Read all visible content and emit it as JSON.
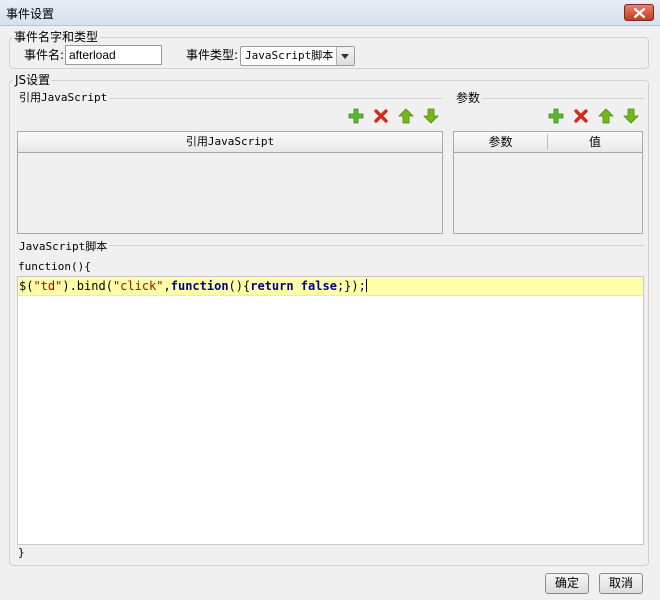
{
  "window": {
    "title": "事件设置"
  },
  "event_group": {
    "legend": "事件名字和类型",
    "name_label": "事件名:",
    "name_value": "afterload",
    "type_label": "事件类型:",
    "type_value": "JavaScript脚本"
  },
  "js_group": {
    "legend": "JS设置",
    "refs": {
      "legend": "引用JavaScript",
      "column_header": "引用JavaScript",
      "rows": []
    },
    "params": {
      "legend": "参数",
      "columns": [
        "参数",
        "值"
      ],
      "rows": []
    },
    "toolbar_icons": [
      "add-icon",
      "delete-icon",
      "move-up-icon",
      "move-down-icon"
    ],
    "script": {
      "legend": "JavaScript脚本",
      "header": "function(){",
      "footer": "}",
      "code": {
        "t1": "$(",
        "t2": "\"td\"",
        "t3": ").bind(",
        "t4": "\"click\"",
        "t5": ",",
        "t6": "function",
        "t7": "(){",
        "t8": "return false",
        "t9": ";});"
      }
    }
  },
  "buttons": {
    "ok": "确定",
    "cancel": "取消"
  },
  "colors": {
    "highlight_line": "#ffffaa",
    "keyword": "#00008b",
    "string": "#c00000",
    "add": "#5cb82e",
    "delete": "#d42a1e",
    "arrow": "#74b61b"
  }
}
